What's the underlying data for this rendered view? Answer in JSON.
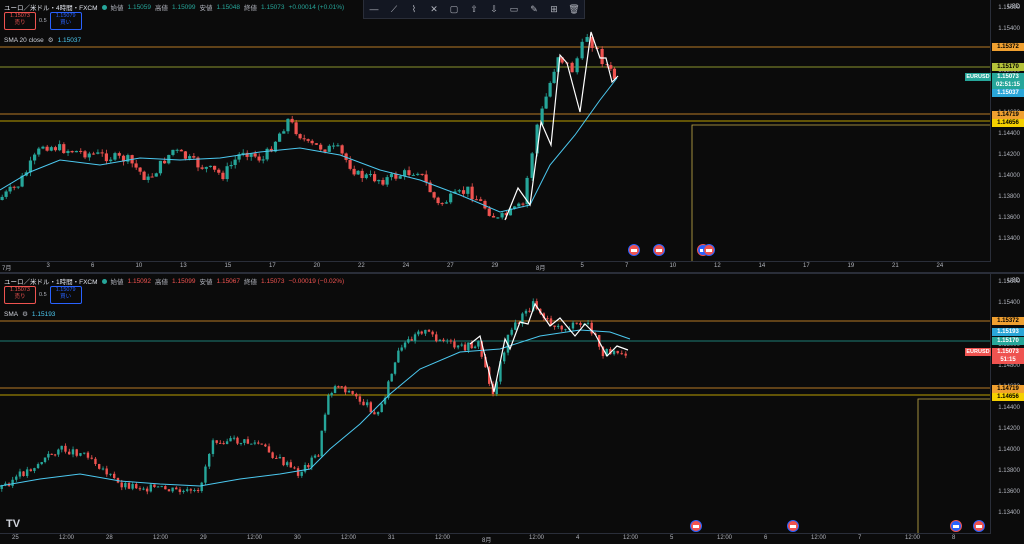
{
  "top": {
    "title": "ユーロ／米ドル・4時間・FXCM",
    "ohlc": {
      "o_label": "始値",
      "o": "1.15059",
      "h_label": "高値",
      "h": "1.15099",
      "l_label": "安値",
      "l": "1.15048",
      "c_label": "終値",
      "c": "1.15073",
      "change": "+0.00014 (+0.01%)"
    },
    "sell_price": "1.15073",
    "sell_label": "売り",
    "spread": "0.5",
    "buy_price": "1.15079",
    "buy_label": "買い",
    "indicator": {
      "name": "SMA 20 close",
      "value": "1.15037"
    },
    "currency": "USD",
    "price_labels": [
      "1.15600",
      "1.15400",
      "1.15200",
      "1.15000",
      "1.14800",
      "1.14600",
      "1.14400",
      "1.14200",
      "1.14000",
      "1.13800",
      "1.13600",
      "1.13400"
    ],
    "tags": {
      "level1": "1.15372",
      "level2": "1.15170",
      "last": "1.15073",
      "countdown": "02:51:15",
      "sma": "1.15037",
      "level3": "1.14719",
      "level4": "1.14656",
      "symbol": "EURUSD"
    },
    "time_ticks": [
      "7月",
      "3",
      "6",
      "10",
      "13",
      "15",
      "17",
      "20",
      "22",
      "24",
      "27",
      "29",
      "8月",
      "5",
      "7",
      "10",
      "12",
      "14",
      "17",
      "19",
      "21",
      "24"
    ]
  },
  "bottom": {
    "title": "ユーロ／米ドル・1時間・FXCM",
    "ohlc": {
      "o_label": "始値",
      "o": "1.15092",
      "h_label": "高値",
      "h": "1.15099",
      "l_label": "安値",
      "l": "1.15067",
      "c_label": "終値",
      "c": "1.15073",
      "change": "−0.00019 (−0.02%)"
    },
    "sell_price": "1.15073",
    "sell_label": "売り",
    "spread": "0.5",
    "buy_price": "1.15079",
    "buy_label": "買い",
    "indicator": {
      "name": "SMA",
      "value": "1.15193"
    },
    "currency": "USD",
    "price_labels": [
      "1.15600",
      "1.15400",
      "1.15200",
      "1.15000",
      "1.14800",
      "1.14600",
      "1.14400",
      "1.14200",
      "1.14000",
      "1.13800",
      "1.13600",
      "1.13400"
    ],
    "tags": {
      "level1": "1.15372",
      "sma": "1.15193",
      "level2": "1.15170",
      "last": "1.15073",
      "countdown": "51:15",
      "level3": "1.14719",
      "level4": "1.14656",
      "symbol": "EURUSD"
    },
    "time_ticks": [
      "25",
      "12:00",
      "28",
      "12:00",
      "29",
      "12:00",
      "30",
      "12:00",
      "31",
      "12:00",
      "8月",
      "12:00",
      "4",
      "12:00",
      "5",
      "12:00",
      "6",
      "12:00",
      "7",
      "12:00",
      "8"
    ]
  },
  "toolbar_icons": [
    "horizontal-line-icon",
    "trend-path-icon",
    "polyline-icon",
    "cross-line-icon",
    "rectangle-icon",
    "arrow-up-icon",
    "arrow-down-icon",
    "callout-icon",
    "brush-icon",
    "ruler-icon",
    "delete-icon"
  ],
  "colors": {
    "up": "#26a69a",
    "down": "#ef5350",
    "sma": "#4cc9f0",
    "level": "#f0a030",
    "level_alt": "#c8b04a"
  }
}
